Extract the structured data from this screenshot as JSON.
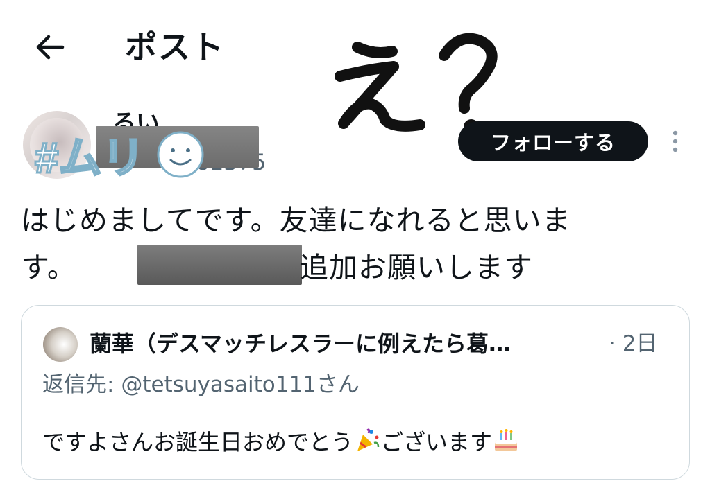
{
  "header": {
    "title": "ポスト",
    "back_icon": "arrow-left-icon"
  },
  "overlay": {
    "annotation": "え?"
  },
  "author": {
    "display_name_partial": "るい",
    "handle_partial": "go1375",
    "sticker_text": "#ムリ",
    "sticker_icon": "smiley-face-icon"
  },
  "actions": {
    "follow_label": "フォローする",
    "more_icon": "more-vertical-icon"
  },
  "post": {
    "line1": "はじめましてです。友達になれると思いま",
    "line2_start": "す。",
    "line2_end": "追加お願いします"
  },
  "quoted_post": {
    "author_name": "蘭華（デスマッチレスラーに例えたら葛…",
    "time": "· 2日",
    "reply_prefix": "返信先: ",
    "reply_handle": "@tetsuyasaito111",
    "reply_suffix": "さん",
    "text_a": "ですよさんお誕生日おめでとう",
    "text_b": "ございます",
    "emoji_1": "party-popper-icon",
    "emoji_2": "birthday-cake-icon"
  },
  "colors": {
    "text_primary": "#0f1419",
    "text_secondary": "#536471",
    "border": "#cfd9de",
    "button_bg": "#0f1419",
    "redaction": "#6f6f6f",
    "sticker_outline": "#7fb0c8"
  }
}
